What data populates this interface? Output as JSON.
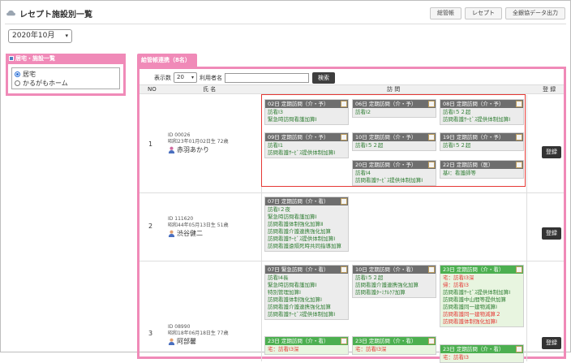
{
  "page": {
    "title": "レセプト施設別一覧"
  },
  "top_buttons": [
    "総管帳",
    "レセプト",
    "全銀協データ出力"
  ],
  "month_select": "2020年10月",
  "left_panel": {
    "title": "居宅・施設一覧",
    "options": [
      {
        "label": "居宅",
        "selected": true
      },
      {
        "label": "かるがもホーム",
        "selected": false
      }
    ]
  },
  "main_tab": "給管帳連携（8名）",
  "filter": {
    "display_count_label": "表示数",
    "display_count": "20",
    "user_name_label": "利用者名",
    "search_label": "検索"
  },
  "table": {
    "headers": {
      "no": "NO",
      "name": "氏 名",
      "visit": "訪 問",
      "register": "登 録"
    }
  },
  "register_label": "登録",
  "rows": [
    {
      "no": "1",
      "id": "ID 00026",
      "birth": "昭和23年01月02日生 72歳",
      "name": "赤羽あかり",
      "cards": [
        {
          "title": "02日 定期訪問（介・予）",
          "lines": [
            "訪看Ⅰ3",
            "緊急時訪問看護加算Ⅰ"
          ]
        },
        {
          "title": "06日 定期訪問（介・予）",
          "lines": [
            "訪看Ⅰ2"
          ]
        },
        {
          "title": "08日 定期訪問（介・予）",
          "lines": [
            "訪看Ⅰ５２超",
            "訪問看護ｻｰﾋﾞｽ提供体制加算Ⅰ"
          ]
        },
        {
          "title": "09日 定期訪問（介・予）",
          "lines": [
            "訪看Ⅰ1",
            "訪問看護ｻｰﾋﾞｽ提供体制加算Ⅰ"
          ]
        },
        {
          "title": "10日 定期訪問（介・予）",
          "lines": [
            "訪看Ⅰ５２超"
          ]
        },
        {
          "title": "19日 定期訪問（介・予）",
          "lines": [
            "訪看Ⅰ５２超"
          ]
        },
        {
          "title": "20日 定期訪問（介・予）",
          "lines": [
            "訪看Ⅰ4",
            "訪問看護ｻｰﾋﾞｽ提供体制加算Ⅰ"
          ]
        },
        {
          "title": "22日 定期訪問（医）",
          "lines": [
            "基Ⅰ：看護師等"
          ]
        }
      ]
    },
    {
      "no": "2",
      "id": "ID 111620",
      "birth": "昭和44年05月13日生 51歳",
      "name": "渋谷健二",
      "cards": [
        {
          "title": "07日 定期訪問（介・看）",
          "lines": [
            "訪看Ⅰ２夜",
            "緊急時訪問看護加算Ⅰ",
            "訪問看護体制強化加算Ⅱ",
            "訪問看護介護連携強化加算",
            "訪問看護ｻｰﾋﾞｽ提供体制加算Ⅰ",
            "訪問看護遠隔死時共同指導加算"
          ]
        }
      ]
    },
    {
      "no": "3",
      "id": "ID 08990",
      "birth": "昭和18年06月18日生 77歳",
      "name": "阿部馨",
      "cards": [
        {
          "title": "07日 緊急訪問（介・看）",
          "lines": [
            "訪看Ⅰ4長",
            "緊急時訪問看護加算Ⅰ",
            "特別管理加算Ⅰ",
            "訪問看護体制強化加算Ⅰ",
            "訪問看護介護連携強化加算",
            "訪問看護ｻｰﾋﾞｽ提供体制加算Ⅰ"
          ]
        },
        {
          "title": "10日 定期訪問（介・看）",
          "lines": [
            "訪看Ⅰ５２超",
            "訪問看護介護連携強化加算",
            "訪問看護ﾀｰﾐﾅﾙｹｱ加算"
          ]
        },
        {
          "title": "23日 定期訪問（介・看）",
          "lines": [
            "宅：訪看Ⅰ3深",
            "帰：訪看Ⅰ3",
            "訪問看護ｻｰﾋﾞｽ提供体制加算Ⅰ",
            "訪問看護中山間等提供加算",
            "訪問看護同一建物減算Ⅰ",
            "訪問看護同一建物減算２",
            "訪問看護体制強化加算Ⅰ"
          ],
          "red_lines": [
            0,
            1,
            5,
            6
          ]
        },
        {
          "title": "23日 定期訪問（介・看）",
          "lines": [
            "宅：訪看Ⅰ3深"
          ]
        },
        {
          "title": "23日 定期訪問（介・看）",
          "lines": [
            "宅：訪看Ⅰ3深"
          ]
        },
        {
          "title": "23日 定期訪問（介・看）",
          "lines": [
            "宅：訪看Ⅰ3"
          ]
        }
      ]
    }
  ]
}
